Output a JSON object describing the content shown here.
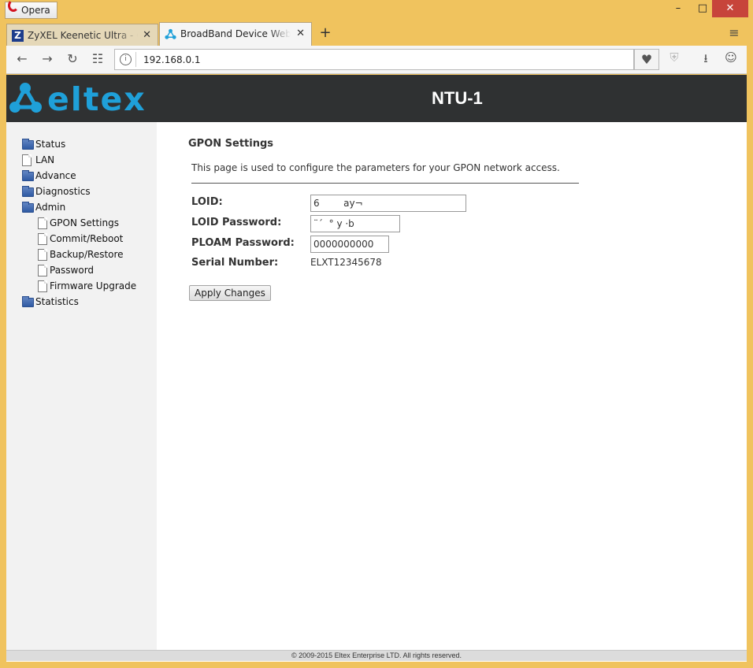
{
  "window": {
    "app_button": "Opera",
    "controls": {
      "minimize": "–",
      "maximize": "□",
      "close": "✕"
    }
  },
  "tabs": [
    {
      "title": "ZyXEL Keenetic Ultra - Con",
      "favicon": "Z",
      "active": false
    },
    {
      "title": "BroadBand Device Webser",
      "active": true
    }
  ],
  "address_bar": {
    "url": "192.168.0.1"
  },
  "icons": {
    "back": "←",
    "forward": "→",
    "reload": "↻",
    "speed_dial": "☷",
    "heart": "♥",
    "shield": "⛨",
    "download": "⭳",
    "account": "☺",
    "new_tab": "+",
    "tab_menu": "≡",
    "tab_close": "✕",
    "site_info": "i"
  },
  "header": {
    "brand": "eltex",
    "device": "NTU-1",
    "brand_color": "#1fa0d9"
  },
  "sidebar": {
    "items": [
      {
        "label": "Status",
        "type": "folder"
      },
      {
        "label": "LAN",
        "type": "doc"
      },
      {
        "label": "Advance",
        "type": "folder"
      },
      {
        "label": "Diagnostics",
        "type": "folder"
      },
      {
        "label": "Admin",
        "type": "folder"
      },
      {
        "label": "GPON Settings",
        "type": "doc",
        "child": true
      },
      {
        "label": "Commit/Reboot",
        "type": "doc",
        "child": true
      },
      {
        "label": "Backup/Restore",
        "type": "doc",
        "child": true
      },
      {
        "label": "Password",
        "type": "doc",
        "child": true
      },
      {
        "label": "Firmware Upgrade",
        "type": "doc",
        "child": true
      },
      {
        "label": "Statistics",
        "type": "folder"
      }
    ]
  },
  "main": {
    "heading": "GPON Settings",
    "description": "This page is used to configure the parameters for your GPON network access.",
    "fields": {
      "loid": {
        "label": "LOID:",
        "value": "6        ay¬"
      },
      "loid_password": {
        "label": "LOID Password:",
        "value": "¨´  ° y ·b"
      },
      "ploam_password": {
        "label": "PLOAM Password:",
        "value": "0000000000"
      },
      "serial_number": {
        "label": "Serial Number:",
        "value": "ELXT12345678"
      }
    },
    "apply_label": "Apply Changes"
  },
  "footer": {
    "text": "© 2009-2015 Eltex Enterprise LTD. All rights reserved."
  }
}
